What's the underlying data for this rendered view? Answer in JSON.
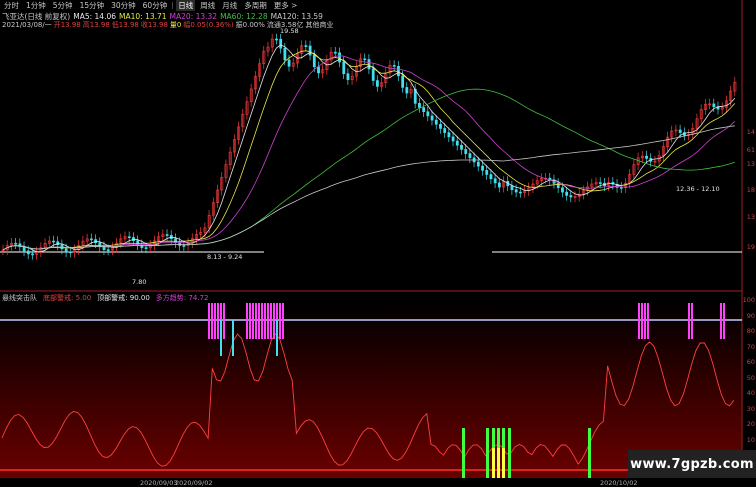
{
  "toolbar": {
    "tabs": [
      {
        "label": "分时",
        "active": false
      },
      {
        "label": "1分钟",
        "active": false
      },
      {
        "label": "5分钟",
        "active": false
      },
      {
        "label": "15分钟",
        "active": false
      },
      {
        "label": "30分钟",
        "active": false
      },
      {
        "label": "60分钟",
        "active": false
      },
      {
        "label": "日线",
        "active": true
      },
      {
        "label": "周线",
        "active": false
      },
      {
        "label": "月线",
        "active": false
      },
      {
        "label": "多周期",
        "active": false
      },
      {
        "label": "更多 >",
        "active": false
      }
    ]
  },
  "main_chart": {
    "title": "飞亚达(日线 前复权)",
    "ma_legend": [
      {
        "label": "MA5: 14.06",
        "color": "#e8e8e8"
      },
      {
        "label": "MA10: 13.71",
        "color": "#e8e840"
      },
      {
        "label": "MA20: 13.32",
        "color": "#d040d0"
      },
      {
        "label": "MA60: 12.28",
        "color": "#40c040"
      },
      {
        "label": "MA120: 13.59",
        "color": "#c8c8c8"
      }
    ],
    "info_line": [
      {
        "text": "2021/03/08/一",
        "color": "#c8c8c8"
      },
      {
        "text": "开13.98",
        "color": "#e04040"
      },
      {
        "text": "高13.98",
        "color": "#e04040"
      },
      {
        "text": "低13.98",
        "color": "#e04040"
      },
      {
        "text": "收13.98",
        "color": "#e04040"
      },
      {
        "text": "量0",
        "color": "#e8e840"
      },
      {
        "text": "幅0.05(0.36%)",
        "color": "#e04040"
      },
      {
        "text": "振0.00%",
        "color": "#c8c8c8"
      },
      {
        "text": "流通3.58亿",
        "color": "#c8c8c8"
      },
      {
        "text": "其他商业",
        "color": "#c8c8c8"
      }
    ],
    "price_tags": {
      "high": "19.58",
      "low": "7.80",
      "mid_left": "8.13 - 9.24",
      "mid_right": "12.36 - 12.10"
    },
    "right_axis": [
      "14",
      "61",
      "13",
      "18",
      "13",
      "19"
    ]
  },
  "indicator": {
    "legend": [
      {
        "text": "悬线突击队",
        "color": "#c8c8c8"
      },
      {
        "text": "底部警戒: 5.00",
        "color": "#e04040"
      },
      {
        "text": "顶部警戒: 90.00",
        "color": "#e8e8e8"
      },
      {
        "text": "多方趋势: 74.72",
        "color": "#d040d0"
      }
    ],
    "right_axis": [
      "100",
      "90",
      "80",
      "70",
      "60",
      "50",
      "40",
      "30",
      "20",
      "10"
    ]
  },
  "watermark": "www.7gpzb.com",
  "bottom_axis": [
    "2020/09/03",
    "2020/09/02",
    "2020/10/02"
  ],
  "colors": {
    "up": "#ff3c3c",
    "down": "#40e0f0",
    "ma5": "#e8e8e8",
    "ma10": "#e8e840",
    "ma20": "#d040d0",
    "ma60": "#40c040",
    "ma120": "#c8c8c8",
    "indicator_line": "#ff4040",
    "top_line": "#c8c8ff",
    "bottom_line": "#ff3030",
    "magenta": "#ff40ff",
    "green": "#40ff40",
    "yellow": "#ffff40"
  }
}
